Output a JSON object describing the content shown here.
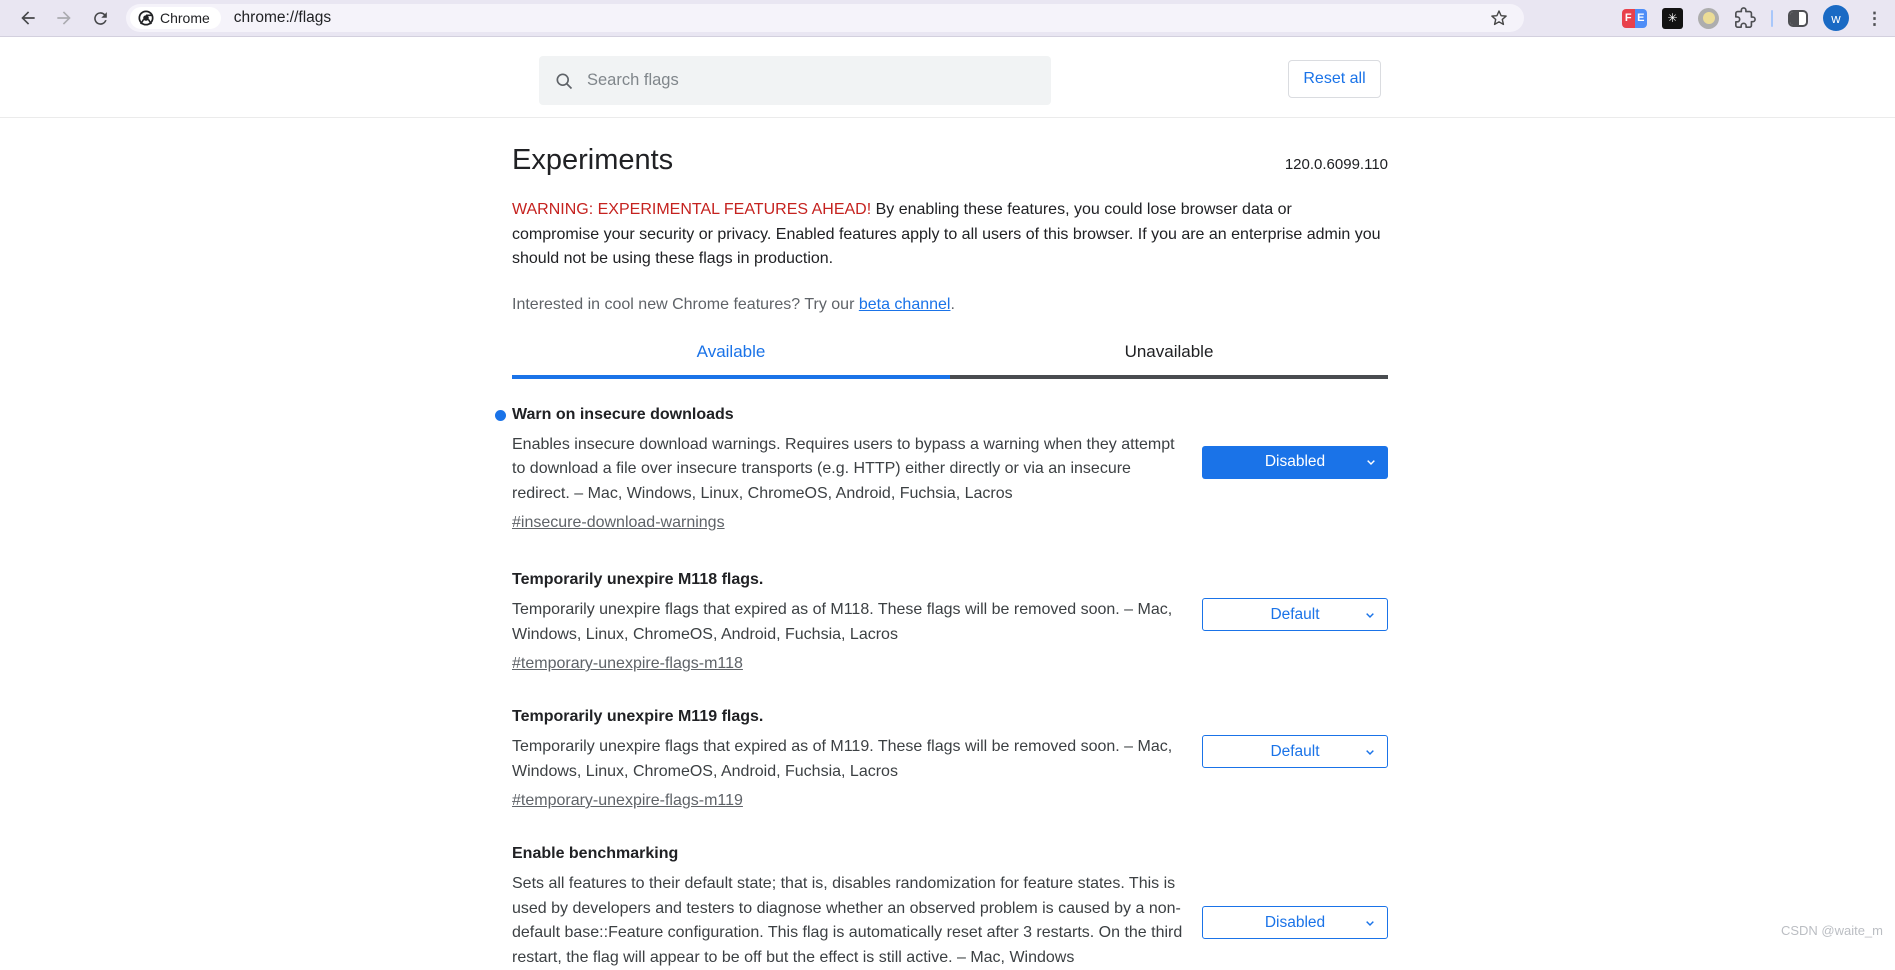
{
  "browser": {
    "url": "chrome://flags",
    "chip_label": "Chrome",
    "profile_initial": "w",
    "extensions": {
      "fe_left": "F",
      "fe_right": "E",
      "black_glyph": "✳"
    }
  },
  "header": {
    "search_placeholder": "Search flags",
    "reset_all_label": "Reset all"
  },
  "page": {
    "title": "Experiments",
    "version": "120.0.6099.110",
    "warning_highlight": "WARNING: EXPERIMENTAL FEATURES AHEAD!",
    "warning_rest": " By enabling these features, you could lose browser data or compromise your security or privacy. Enabled features apply to all users of this browser. If you are an enterprise admin you should not be using these flags in production.",
    "promo_prefix": "Interested in cool new Chrome features? Try our ",
    "promo_link": "beta channel",
    "promo_suffix": ".",
    "tabs": [
      {
        "label": "Available",
        "active": true
      },
      {
        "label": "Unavailable",
        "active": false
      }
    ]
  },
  "flags": [
    {
      "title": "Warn on insecure downloads",
      "modified": true,
      "description": "Enables insecure download warnings. Requires users to bypass a warning when they attempt to download a file over insecure transports (e.g. HTTP) either directly or via an insecure redirect. – Mac, Windows, Linux, ChromeOS, Android, Fuchsia, Lacros",
      "permalink": "#insecure-download-warnings",
      "value": "Disabled"
    },
    {
      "title": "Temporarily unexpire M118 flags.",
      "modified": false,
      "description": "Temporarily unexpire flags that expired as of M118. These flags will be removed soon. – Mac, Windows, Linux, ChromeOS, Android, Fuchsia, Lacros",
      "permalink": "#temporary-unexpire-flags-m118",
      "value": "Default"
    },
    {
      "title": "Temporarily unexpire M119 flags.",
      "modified": false,
      "description": "Temporarily unexpire flags that expired as of M119. These flags will be removed soon. – Mac, Windows, Linux, ChromeOS, Android, Fuchsia, Lacros",
      "permalink": "#temporary-unexpire-flags-m119",
      "value": "Default"
    },
    {
      "title": "Enable benchmarking",
      "modified": false,
      "description": "Sets all features to their default state; that is, disables randomization for feature states. This is used by developers and testers to diagnose whether an observed problem is caused by a non-default base::Feature configuration. This flag is automatically reset after 3 restarts. On the third restart, the flag will appear to be off but the effect is still active. – Mac, Windows",
      "permalink": "",
      "value": "Disabled"
    }
  ],
  "watermark": "CSDN @waite_m",
  "colors": {
    "accent": "#1A73E8",
    "warning_red": "#C5221F",
    "toolbar_bg": "#E9E6F2"
  }
}
